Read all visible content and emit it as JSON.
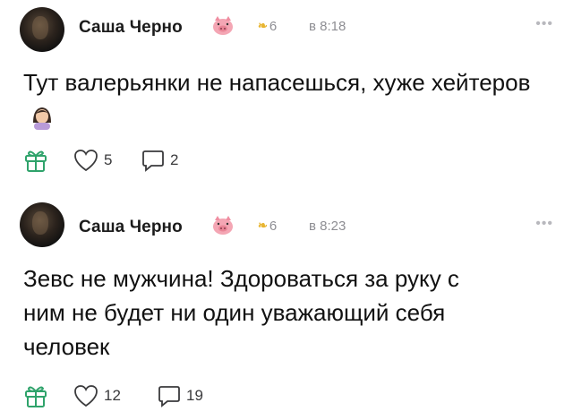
{
  "posts": [
    {
      "author": "Саша Черно",
      "level": "6",
      "time": "в 8:18",
      "text": "Тут валерьянки не напасешься, хуже хейтеров",
      "likes": "5",
      "comments": "2"
    },
    {
      "author": "Саша Черно",
      "level": "6",
      "time": "в 8:23",
      "text": "Зевс не мужчина! Здороваться за руку с ним не будет ни один уважающий себя человек",
      "likes": "12",
      "comments": "19"
    }
  ],
  "icons": {
    "avatar": "avatar",
    "badge": "pig-face-icon",
    "level": "laurel-wreath-icon",
    "more": "more-dots-icon",
    "gift": "gift-icon",
    "like": "heart-icon",
    "comment": "comment-bubble-icon",
    "emoji": "woman-facepalming-emoji"
  },
  "colors": {
    "muted": "#8e8e93",
    "gold": "#e8b531",
    "text": "#111111"
  }
}
